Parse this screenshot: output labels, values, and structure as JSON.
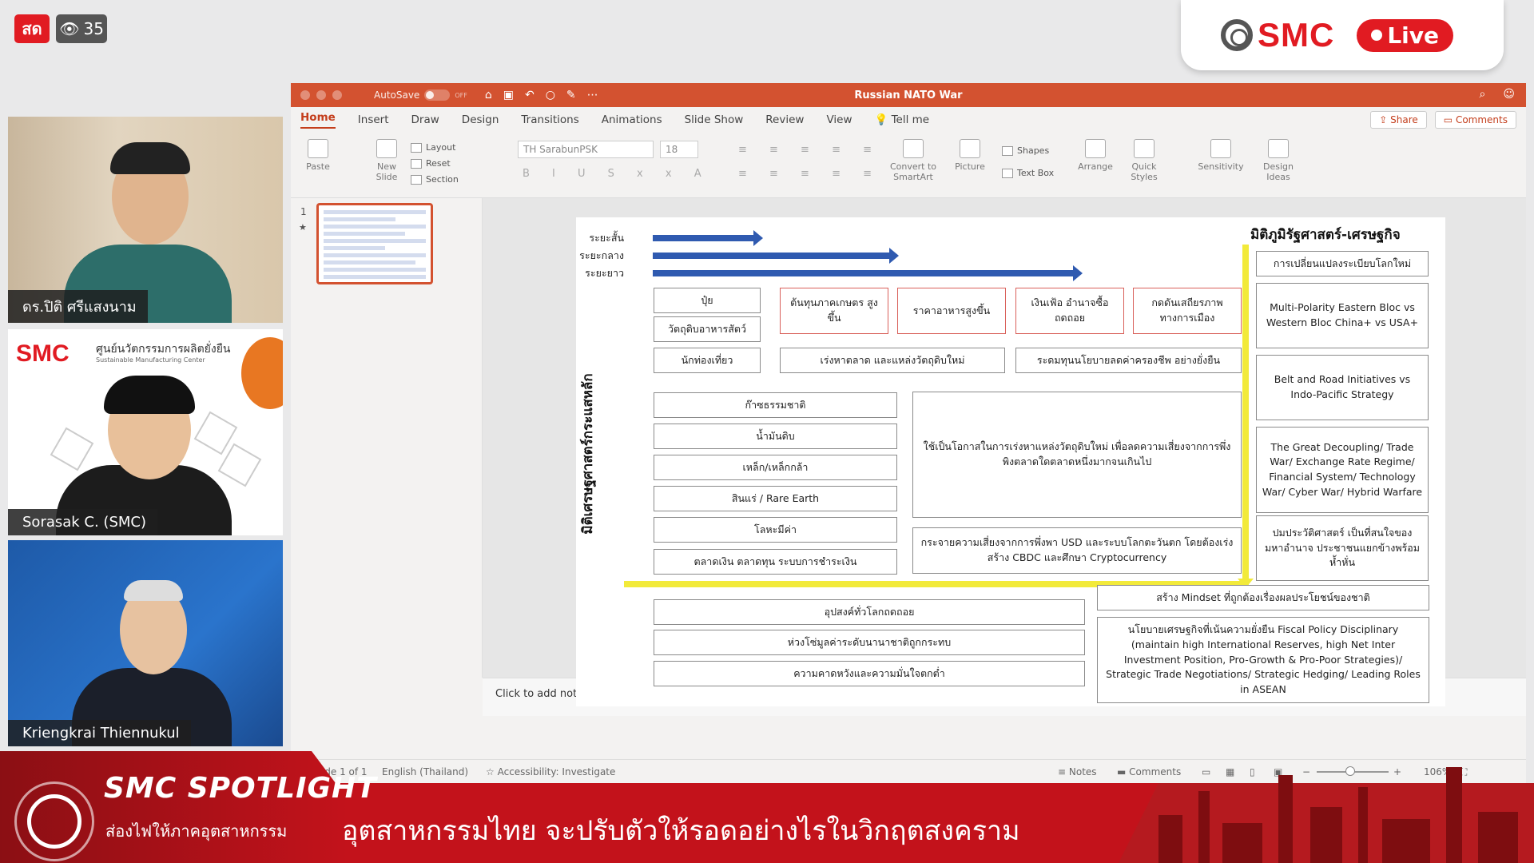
{
  "stream": {
    "live_badge": "สด",
    "viewer_count": "35",
    "brand": "SMC",
    "brand_live": "Live"
  },
  "participants": [
    {
      "name": "ดร.ปิติ ศรีแสงนาม"
    },
    {
      "name": "Sorasak C. (SMC)"
    },
    {
      "name": "Kriengkrai Thiennukul"
    }
  ],
  "tile2_bg": {
    "logo": "SMC",
    "center_title": "ศูนย์นวัตกรรมการผลิตยั่งยืน",
    "center_sub": "Sustainable Manufacturing Center"
  },
  "ppt": {
    "autosave": "AutoSave",
    "toggle_state": "OFF",
    "doc_title": "Russian NATO War",
    "tabs": [
      "Home",
      "Insert",
      "Draw",
      "Design",
      "Transitions",
      "Animations",
      "Slide Show",
      "Review",
      "View",
      "Tell me"
    ],
    "share": "Share",
    "comments": "Comments",
    "ribbon": {
      "paste": "Paste",
      "new_slide": "New Slide",
      "layout": "Layout",
      "reset": "Reset",
      "section": "Section",
      "font": "TH SarabunPSK",
      "size": "18",
      "convert": "Convert to SmartArt",
      "picture": "Picture",
      "shapes": "Shapes",
      "text_box": "Text Box",
      "arrange": "Arrange",
      "quick_styles": "Quick Styles",
      "sensitivity": "Sensitivity",
      "design_ideas": "Design Ideas"
    },
    "slide_number": "1",
    "notes_placeholder": "Click to add notes",
    "status": {
      "slide": "Slide 1 of 1",
      "language": "English (Thailand)",
      "accessibility": "Accessibility: Investigate",
      "notes": "Notes",
      "comments": "Comments",
      "zoom": "106%"
    }
  },
  "slide": {
    "terms": [
      "ระยะสั้น",
      "ระยะกลาง",
      "ระยะยาว"
    ],
    "right_title": "มิติภูมิรัฐศาสตร์-เศรษฐกิจ",
    "vertical_title": "มิติเศรษฐศาสตร์กระแสหลัก",
    "row1": [
      "ปุ๋ย",
      "ต้นทุนภาคเกษตร สูงขึ้น",
      "ราคาอาหารสูงขึ้น",
      "เงินเฟ้อ อำนาจซื้อ ถดถอย",
      "กดดันเสถียรภาพ ทางการเมือง"
    ],
    "row1b": "วัตถุดิบอาหารสัตว์",
    "row2": [
      "นักท่องเที่ยว",
      "เร่งหาตลาด และแหล่งวัตถุดิบใหม่",
      "ระดมทุนนโยบายลดค่าครองชีพ อย่างยั่งยืน"
    ],
    "commodities": [
      "ก๊าซธรรมชาติ",
      "น้ำมันดิบ",
      "เหล็ก/เหล็กกล้า",
      "สินแร่ / Rare Earth",
      "โลหะมีค่า",
      "ตลาดเงิน ตลาดทุน ระบบการชำระเงิน"
    ],
    "opportunity": "ใช้เป็นโอกาสในการเร่งหาแหล่งวัตถุดิบใหม่ เพื่อลดความเสี่ยงจากการพึ่งพิงตลาดใดตลาดหนึ่งมากจนเกินไป",
    "usd_box": "กระจายความเสี่ยงจากการพึ่งพา USD และระบบโลกตะวันตก โดยต้องเร่งสร้าง CBDC และศึกษา Cryptocurrency",
    "geo": [
      "การเปลี่ยนแปลงระเบียบโลกใหม่",
      "Multi-Polarity Eastern Bloc vs Western Bloc China+ vs USA+",
      "Belt and Road Initiatives vs Indo-Pacific Strategy",
      "The Great Decoupling/ Trade War/ Exchange Rate Regime/ Financial System/ Technology War/ Cyber War/ Hybrid Warfare",
      "ปมประวัติศาสตร์ เป็นที่สนใจของมหาอำนาจ ประชาชนแยกข้างพร้อมห้ำหั่น"
    ],
    "mindset": "สร้าง Mindset ที่ถูกต้องเรื่องผลประโยชน์ของชาติ",
    "bottom_left": [
      "อุปสงค์ทั่วโลกถดถอย",
      "ห่วงโซ่มูลค่าระดับนานาชาติถูกกระทบ",
      "ความคาดหวังและความมั่นใจตกต่ำ"
    ],
    "policy": "นโยบายเศรษฐกิจที่เน้นความยั่งยืน Fiscal Policy Disciplinary (maintain high International Reserves, high Net Inter Investment Position, Pro-Growth & Pro-Poor Strategies)/ Strategic Trade Negotiations/ Strategic Hedging/ Leading Roles in ASEAN"
  },
  "banner": {
    "title": "SMC SPOTLIGHT",
    "subtitle": "ส่องไฟให้ภาคอุตสาหกรรม",
    "headline": "อุตสาหกรรมไทย จะปรับตัวให้รอดอย่างไรในวิกฤตสงคราม"
  },
  "colors": {
    "ppt_accent": "#d35230",
    "live_red": "#e11b22",
    "arrow_blue": "#2f5ab0",
    "yellow_arrow": "#f2ea3a"
  }
}
